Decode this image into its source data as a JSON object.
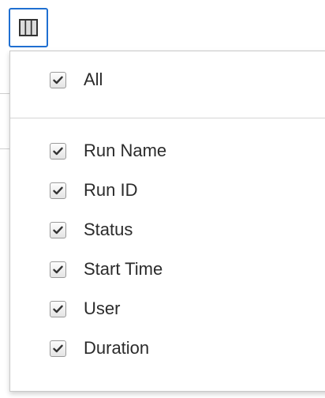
{
  "toolbar": {
    "column_chooser_icon": "columns-icon",
    "accent_color": "#1f6fd1"
  },
  "column_menu": {
    "all": {
      "label": "All",
      "checked": true
    },
    "columns": [
      {
        "label": "Run Name",
        "checked": true
      },
      {
        "label": "Run ID",
        "checked": true
      },
      {
        "label": "Status",
        "checked": true
      },
      {
        "label": "Start Time",
        "checked": true
      },
      {
        "label": "User",
        "checked": true
      },
      {
        "label": "Duration",
        "checked": true
      }
    ]
  }
}
